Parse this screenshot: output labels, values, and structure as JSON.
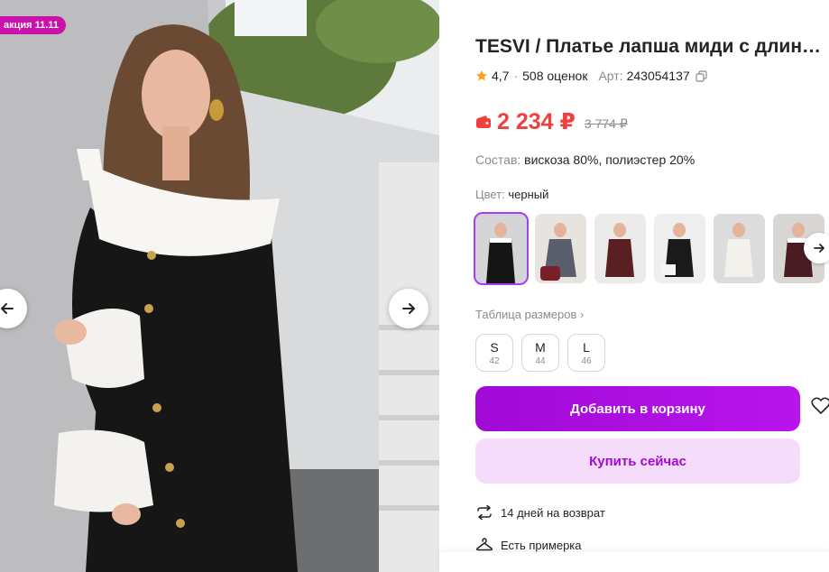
{
  "promo_badge": "акция 11.11",
  "product": {
    "title": "TESVI / Платье лапша миди с длинным рукавом",
    "rating": "4,7",
    "reviews": "508 оценок",
    "article_label": "Арт:",
    "article": "243054137",
    "price": "2 234 ₽",
    "old_price": "3 774 ₽",
    "composition_label": "Состав:",
    "composition": "вискоза 80%, полиэстер 20%",
    "color_label": "Цвет:",
    "color": "черный",
    "size_table": "Таблица размеров ›",
    "sizes": [
      {
        "size": "S",
        "ru": "42"
      },
      {
        "size": "M",
        "ru": "44"
      },
      {
        "size": "L",
        "ru": "46"
      }
    ]
  },
  "actions": {
    "add_to_cart": "Добавить в корзину",
    "buy_now": "Купить сейчас"
  },
  "features": {
    "returns": "14 дней на возврат",
    "fitting": "Есть примерка"
  },
  "icons": {
    "prev": "arrow-left-icon",
    "next": "arrow-right-icon",
    "star": "star-icon",
    "copy": "copy-icon",
    "wallet": "wallet-icon",
    "heart": "heart-icon",
    "returns": "return-arrows-icon",
    "fitting": "hanger-icon"
  },
  "colors": {
    "accent": "#a10ad6",
    "price": "#f0403d",
    "badge": "#cb11ab",
    "buy_bg": "#f5dcfb"
  }
}
